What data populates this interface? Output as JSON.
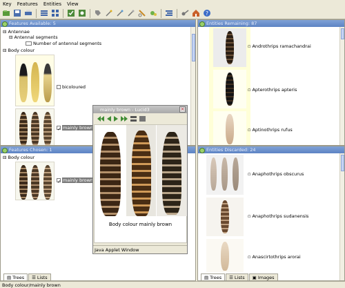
{
  "menu": [
    "Key",
    "Features",
    "Entities",
    "View"
  ],
  "toolbar_icons": [
    "open-icon",
    "save-icon",
    "print-icon",
    "list-icon",
    "grid-icon",
    "tree-icon",
    "find-icon",
    "tag-icon",
    "wand-icon",
    "prune-icon",
    "cut-icon",
    "lasso-icon",
    "sort-icon",
    "bug-icon",
    "home-icon",
    "help-icon"
  ],
  "features_available": {
    "title": "Features Available: 5",
    "tree": [
      {
        "label": "Antennae",
        "indent": 0
      },
      {
        "label": "Antennal segments",
        "indent": 1
      },
      {
        "label": "Number of antennal segments",
        "indent": 2
      },
      {
        "label": "Body colour",
        "indent": 0
      }
    ],
    "states": [
      {
        "label": "bicoloured",
        "checked": false,
        "selected": false
      },
      {
        "label": "mainly brown",
        "checked": true,
        "selected": true
      }
    ]
  },
  "features_chosen": {
    "title": "Features Chosen: 1",
    "tree": [
      {
        "label": "Body colour",
        "indent": 0
      }
    ],
    "states": [
      {
        "label": "mainly brown",
        "checked": true,
        "selected": true
      }
    ]
  },
  "left_tabs": [
    "Trees",
    "Lists"
  ],
  "entities_remaining": {
    "title": "Entities Remaining: 87",
    "items": [
      "Androthrips ramachandrai",
      "Apterothrips apteris",
      "Aptinothrips rufus"
    ]
  },
  "entities_discarded": {
    "title": "Entities Discarded: 24",
    "items": [
      "Anaphothrips obscurus",
      "Anaphothrips sudanensis",
      "Anascirtothrips arorai"
    ]
  },
  "right_tabs": [
    "Trees",
    "Lists",
    "Images"
  ],
  "popup": {
    "title": "mainly brown - Lucid3",
    "caption": "Body colour mainly brown",
    "footer": "Java Applet Window"
  },
  "status": "Body colour/mainly brown",
  "colors": {
    "title_bar": "#6a8fcf",
    "entity_bg": "#ffffd8",
    "selected": "#7b7b7b"
  }
}
